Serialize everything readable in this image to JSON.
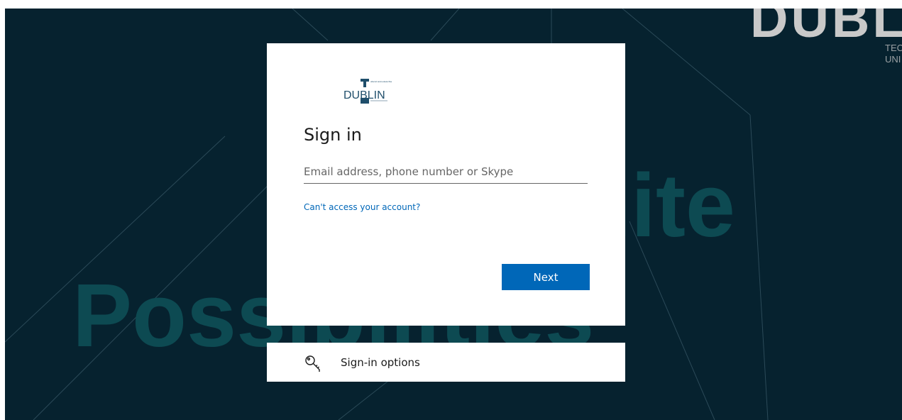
{
  "background": {
    "brand_top": "DUBL",
    "brand_sub_line1": "TEC",
    "brand_sub_line2": "UNI",
    "word_top": "nite",
    "word_bottom": "Possibilities"
  },
  "signin": {
    "logo_text": "DUBLIN",
    "title": "Sign in",
    "email_placeholder": "Email address, phone number or Skype",
    "cant_access_link": "Can't access your account?",
    "next_label": "Next"
  },
  "signin_options": {
    "label": "Sign-in options",
    "icon": "key-icon"
  },
  "colors": {
    "background": "#06222f",
    "accent": "#0067b8",
    "big_text": "#0d4a52"
  }
}
